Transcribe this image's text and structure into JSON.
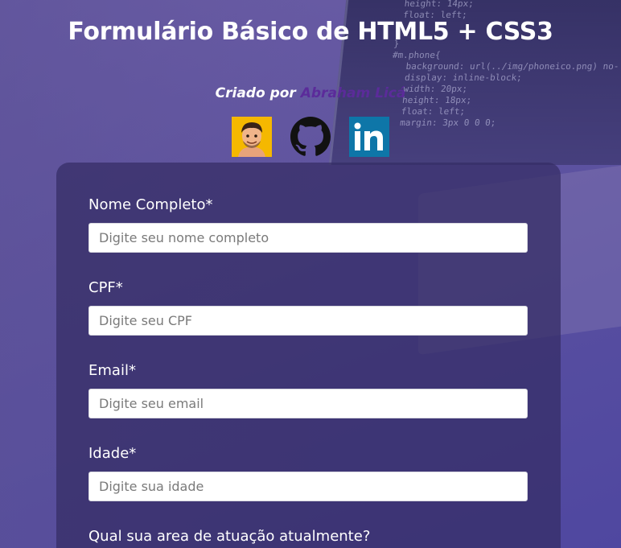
{
  "page": {
    "title": "Formulário Básico de HTML5 + CSS3",
    "credit_prefix": "Criado por",
    "credit_author": "Abraham Licá"
  },
  "social": [
    {
      "name": "avatar",
      "icon": "avatar-icon"
    },
    {
      "name": "github",
      "icon": "github-icon"
    },
    {
      "name": "linkedin",
      "icon": "linkedin-icon",
      "text": "in"
    }
  ],
  "background_code": [
    "height: 14px;",
    "float: left;",
    "}",
    "#m.phone{",
    "background: url(../img/phoneico.png) no-",
    "display: inline-block;",
    "width: 20px;",
    "height: 18px;",
    "float: left;",
    "margin: 3px 0 0 0;"
  ],
  "form": {
    "fields": [
      {
        "label": "Nome Completo*",
        "placeholder": "Digite seu nome completo",
        "value": ""
      },
      {
        "label": "CPF*",
        "placeholder": "Digite seu CPF",
        "value": ""
      },
      {
        "label": "Email*",
        "placeholder": "Digite seu email",
        "value": ""
      },
      {
        "label": "Idade*",
        "placeholder": "Digite sua idade",
        "value": ""
      }
    ],
    "next_question": "Qual sua area de atuação atualmente?"
  },
  "colors": {
    "background": "#5f55a0",
    "card": "#342d64",
    "author_link": "#5b2b9a",
    "avatar_bg": "#f5b800",
    "linkedin_bg": "#0e76a8"
  }
}
